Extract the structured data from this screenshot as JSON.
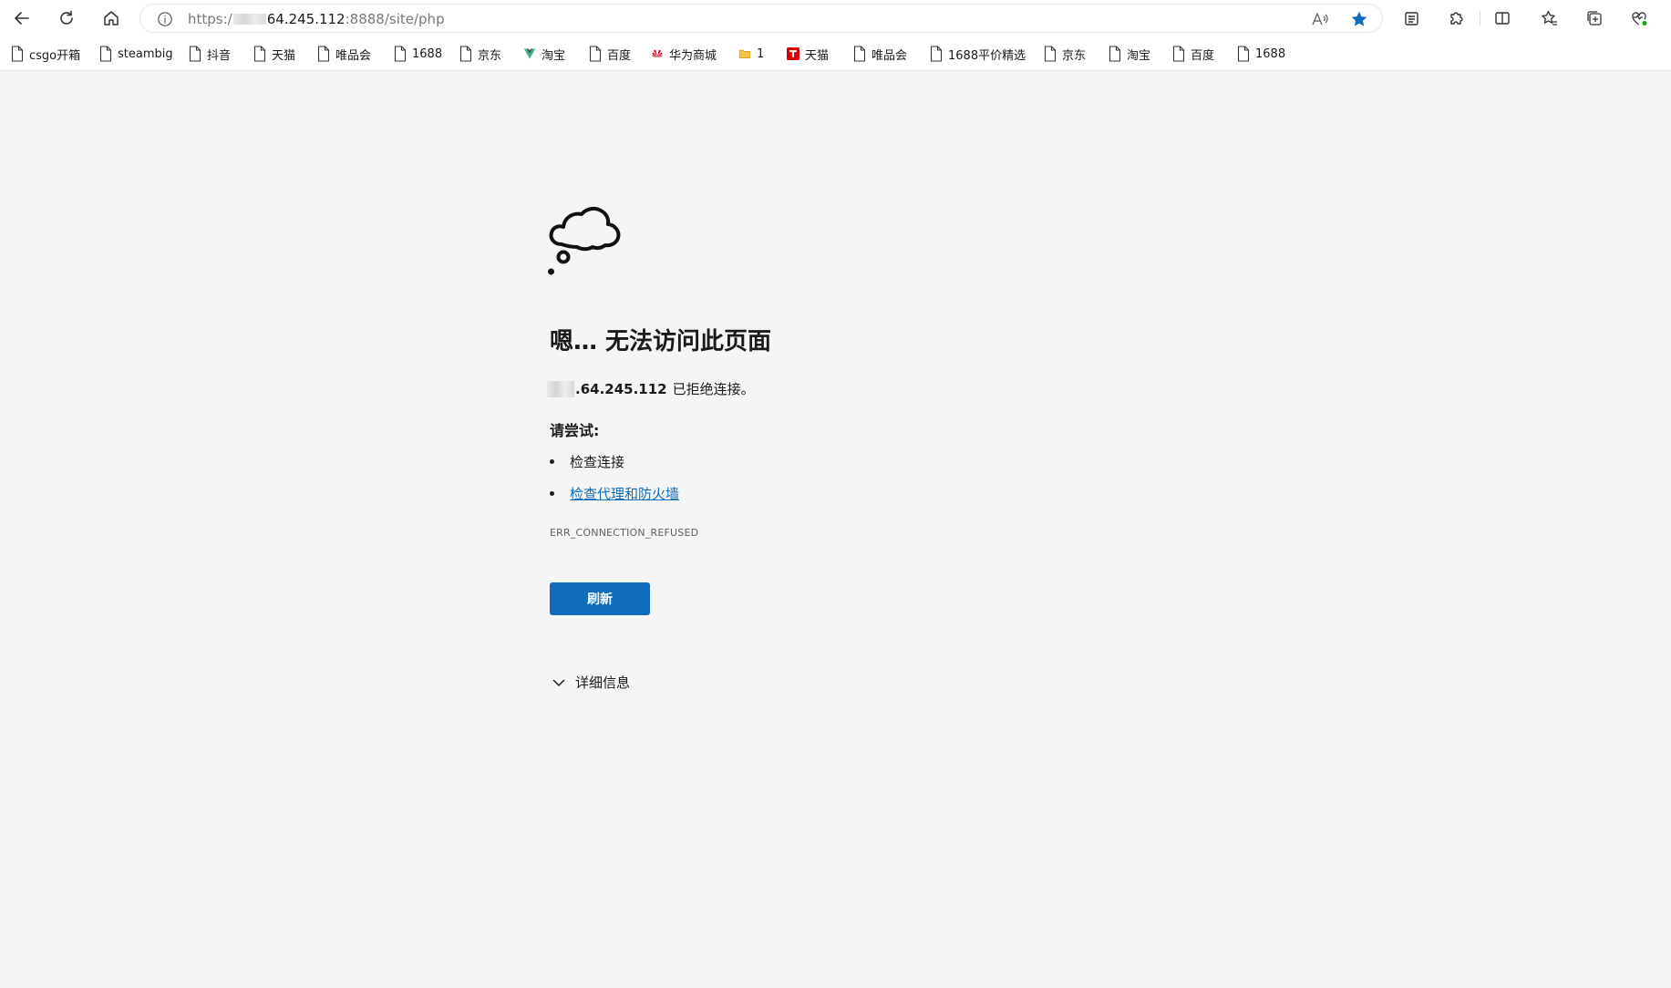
{
  "browser": {
    "address": {
      "protocol": "https:/",
      "host": "64.245.112",
      "path": ":8888/site/php"
    },
    "icons": {
      "back": "arrow-left-icon",
      "refresh": "refresh-icon",
      "home": "home-icon",
      "info": "info-icon",
      "read_aloud": "read-aloud-icon",
      "favorite": "star-filled-icon",
      "tab_actions": "tab-icon",
      "extensions": "puzzle-icon",
      "split_screen": "split-screen-icon",
      "favorites": "favorites-icon",
      "collections": "collections-icon",
      "browser_essentials": "heart-pulse-icon"
    },
    "accent_color": "#0f6cbd"
  },
  "bookmarks": [
    {
      "label": "csgo开箱",
      "icon": "page-icon"
    },
    {
      "label": "steambig",
      "icon": "page-icon"
    },
    {
      "label": "抖音",
      "icon": "page-icon"
    },
    {
      "label": "天猫",
      "icon": "page-icon"
    },
    {
      "label": "唯品会",
      "icon": "page-icon"
    },
    {
      "label": "1688",
      "icon": "page-icon"
    },
    {
      "label": "京东",
      "icon": "page-icon"
    },
    {
      "label": "淘宝",
      "icon": "vue-logo-icon"
    },
    {
      "label": "百度",
      "icon": "page-icon"
    },
    {
      "label": "华为商城",
      "icon": "huawei-logo-icon"
    },
    {
      "label": "1",
      "icon": "folder-icon"
    },
    {
      "label": "天猫",
      "icon": "tmall-logo-icon"
    },
    {
      "label": "唯品会",
      "icon": "page-icon"
    },
    {
      "label": "1688平价精选",
      "icon": "page-icon"
    },
    {
      "label": "京东",
      "icon": "page-icon"
    },
    {
      "label": "淘宝",
      "icon": "page-icon"
    },
    {
      "label": "百度",
      "icon": "page-icon"
    },
    {
      "label": "1688",
      "icon": "page-icon"
    }
  ],
  "error_page": {
    "icon": "thought-cloud-icon",
    "title": "嗯… 无法访问此页面",
    "host": ".64.245.112",
    "refused_text": "已拒绝连接。",
    "try_heading": "请尝试:",
    "suggestions": [
      "检查连接",
      "检查代理和防火墙"
    ],
    "error_code": "ERR_CONNECTION_REFUSED",
    "refresh_label": "刷新",
    "details_label": "详细信息"
  }
}
